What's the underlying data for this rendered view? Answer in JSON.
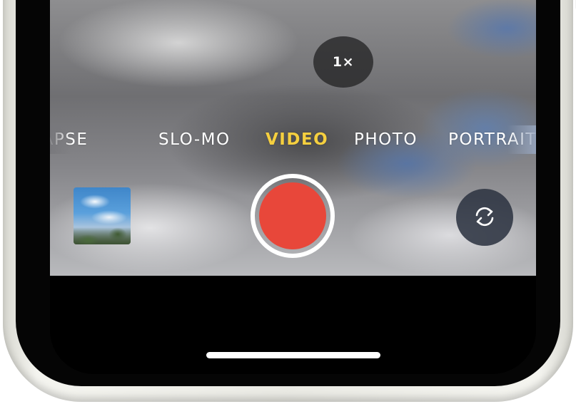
{
  "camera": {
    "zoom_label": "1×",
    "modes": [
      {
        "label": "TIME-LAPSE",
        "visible_label": "E-LAPSE",
        "active": false
      },
      {
        "label": "SLO-MO",
        "active": false
      },
      {
        "label": "VIDEO",
        "active": true
      },
      {
        "label": "PHOTO",
        "active": false
      },
      {
        "label": "PORTRAIT",
        "visible_label": "PORTRAIT",
        "active": false
      }
    ],
    "colors": {
      "active_mode": "#f5cf3f",
      "record_button": "#e8473a",
      "control_background": "#2d3442"
    },
    "icons": {
      "flip": "camera-flip-icon",
      "shutter": "record-button"
    }
  }
}
